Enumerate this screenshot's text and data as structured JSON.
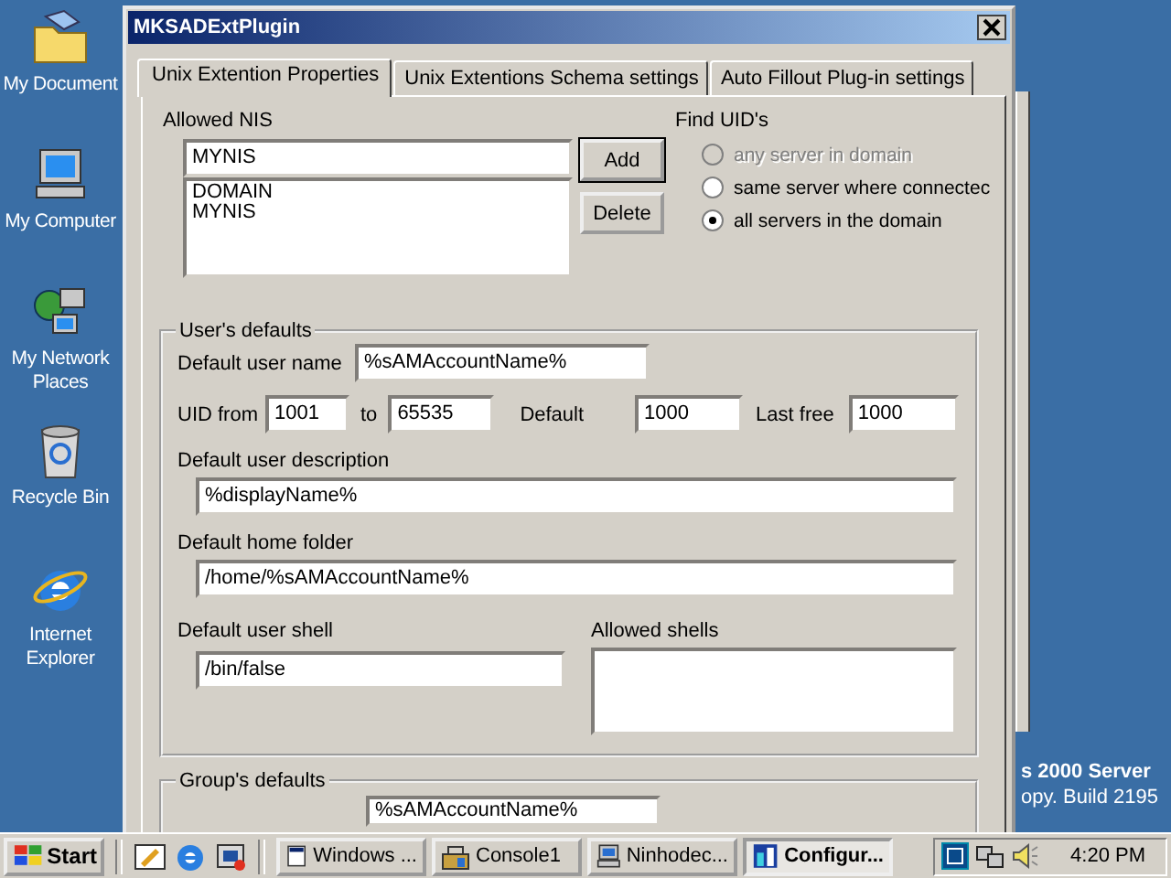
{
  "desktop": {
    "icons": [
      {
        "label": "My Document",
        "kind": "folder"
      },
      {
        "label": "My Computer",
        "kind": "computer"
      },
      {
        "label": "My Network Places",
        "kind": "network"
      },
      {
        "label": "Recycle Bin",
        "kind": "bin"
      },
      {
        "label": "Internet Explorer",
        "kind": "browser"
      }
    ],
    "version_lines": [
      "s 2000 Server",
      "opy. Build 2195"
    ]
  },
  "dialog": {
    "title": "MKSADExtPlugin",
    "tabs": [
      {
        "label": "Unix Extention Properties",
        "selected": true
      },
      {
        "label": "Unix Extentions Schema settings",
        "selected": false
      },
      {
        "label": "Auto Fillout Plug-in settings",
        "selected": false
      }
    ],
    "allowed_nis": {
      "label": "Allowed NIS",
      "value": "MYNIS",
      "items": [
        "DOMAIN",
        "MYNIS"
      ],
      "buttons": [
        {
          "label": "Add",
          "default": true
        },
        {
          "label": "Delete",
          "default": false
        }
      ]
    },
    "find_uids": {
      "label": "Find UID's",
      "options": [
        {
          "label": "any server in domain",
          "selected": false,
          "disabled": true
        },
        {
          "label": "same server where connectec",
          "selected": false,
          "disabled": false
        },
        {
          "label": "all servers in the domain",
          "selected": true,
          "disabled": false
        }
      ]
    },
    "users_defaults": {
      "title": "User's defaults",
      "user_name_label": "Default user name",
      "user_name": "%sAMAccountName%",
      "uid_from_label": "UID from",
      "uid_from": "1001",
      "to_label": "to",
      "uid_to": "65535",
      "default_label": "Default",
      "uid_default": "1000",
      "last_free_label": "Last free",
      "last_free": "1000",
      "description_label": "Default user description",
      "description": "%displayName%",
      "home_label": "Default home folder",
      "home": "/home/%sAMAccountName%",
      "shell_label": "Default user shell",
      "shell": "/bin/false",
      "allowed_shells_label": "Allowed shells"
    },
    "groups_defaults": {
      "title": "Group's defaults",
      "group_name": "%sAMAccountName%"
    }
  },
  "taskbar": {
    "start_label": "Start",
    "tasks": [
      {
        "label": "Windows ...",
        "kind": "window",
        "selected": false
      },
      {
        "label": "Console1",
        "kind": "console",
        "selected": false
      },
      {
        "label": "Ninhodec...",
        "kind": "computer",
        "selected": false
      },
      {
        "label": "Configur...",
        "kind": "config",
        "selected": true
      }
    ],
    "clock": "4:20 PM"
  }
}
